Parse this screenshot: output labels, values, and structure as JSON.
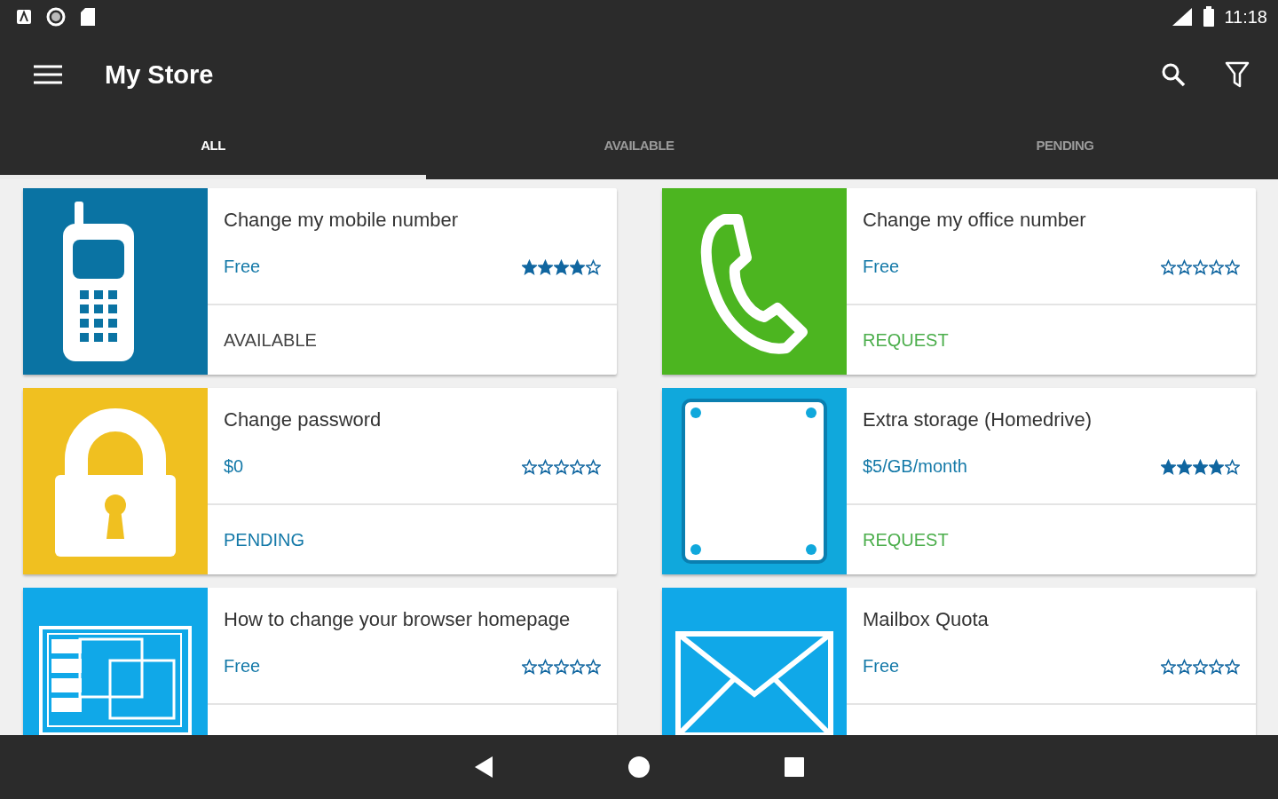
{
  "status_bar": {
    "time": "11:18"
  },
  "app_bar": {
    "title": "My Store"
  },
  "tabs": [
    {
      "label": "ALL",
      "selected": true
    },
    {
      "label": "AVAILABLE",
      "selected": false
    },
    {
      "label": "PENDING",
      "selected": false
    }
  ],
  "items": [
    {
      "title": "Change my mobile number",
      "price": "Free",
      "stars": 4,
      "status": {
        "text": "AVAILABLE",
        "kind": "available"
      },
      "icon": {
        "kind": "mobile",
        "color": "#0a73a3"
      }
    },
    {
      "title": "Change my office number",
      "price": "Free",
      "stars": 0,
      "status": {
        "text": "REQUEST",
        "kind": "request"
      },
      "icon": {
        "kind": "phone",
        "color": "#4cb520"
      }
    },
    {
      "title": "Change password",
      "price": "$0",
      "stars": 0,
      "status": {
        "text": "PENDING",
        "kind": "pending"
      },
      "icon": {
        "kind": "lock",
        "color": "#f0c020"
      }
    },
    {
      "title": "Extra storage (Homedrive)",
      "price": "$5/GB/month",
      "stars": 4,
      "status": {
        "text": "REQUEST",
        "kind": "request"
      },
      "icon": {
        "kind": "storage",
        "color": "#10a8dc"
      }
    },
    {
      "title": "How to change your browser homepage",
      "price": "Free",
      "stars": 0,
      "icon": {
        "kind": "browser",
        "color": "#10a8e8"
      }
    },
    {
      "title": "Mailbox Quota",
      "price": "Free",
      "stars": 0,
      "icon": {
        "kind": "mail",
        "color": "#10a8e8"
      }
    }
  ]
}
